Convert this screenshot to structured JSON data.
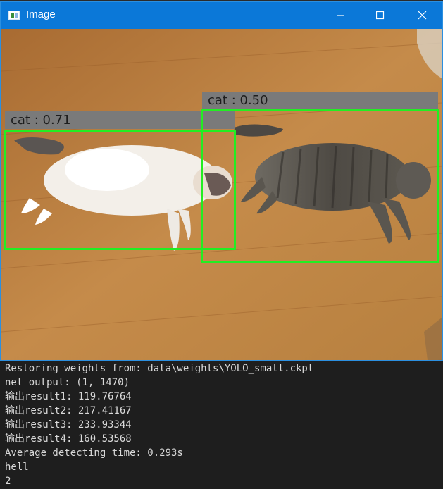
{
  "window": {
    "title": "Image",
    "controls": {
      "minimize_icon": "minimize-icon",
      "maximize_icon": "maximize-icon",
      "close_icon": "close-icon"
    }
  },
  "detections": [
    {
      "label": "cat : 0.71"
    },
    {
      "label": "cat : 0.50"
    }
  ],
  "colors": {
    "box": "#22ee22",
    "label_bg": "#7a7a7a",
    "titlebar": "#0b78d8",
    "console_bg": "#1e1e1e"
  },
  "console": {
    "lines": [
      "Restoring weights from: data\\weights\\YOLO_small.ckpt",
      "net_output: (1, 1470)",
      "输出result1: 119.76764",
      "输出result2: 217.41167",
      "输出result3: 233.93344",
      "输出result4: 160.53568",
      "Average detecting time: 0.293s",
      "hell",
      "2"
    ]
  }
}
